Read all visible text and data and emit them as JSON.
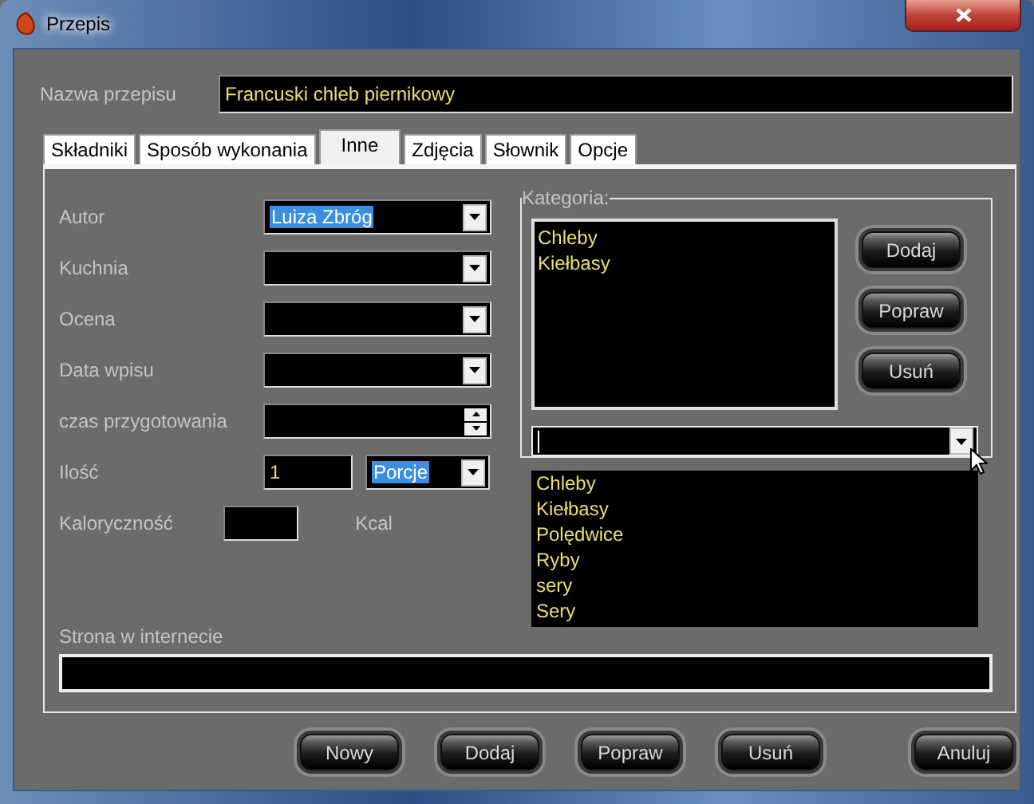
{
  "window": {
    "title": "Przepis"
  },
  "recipe_name": {
    "label": "Nazwa przepisu",
    "value": "Francuski chleb piernikowy"
  },
  "tabs": [
    {
      "label": "Składniki",
      "selected": false
    },
    {
      "label": "Sposób wykonania",
      "selected": false
    },
    {
      "label": "Inne",
      "selected": true
    },
    {
      "label": "Zdjęcia",
      "selected": false
    },
    {
      "label": "Słownik",
      "selected": false
    },
    {
      "label": "Opcje",
      "selected": false
    }
  ],
  "fields": [
    {
      "label": "Autor",
      "kind": "combo",
      "value": "Luiza Zbróg",
      "highlighted": true
    },
    {
      "label": "Kuchnia",
      "kind": "combo"
    },
    {
      "label": "Ocena",
      "kind": "combo"
    },
    {
      "label": "Data wpisu",
      "kind": "combo"
    },
    {
      "label": "czas przygotowania",
      "kind": "spin"
    },
    {
      "label": "Ilość",
      "kind": "amount",
      "value": "1",
      "unit": {
        "value": "Porcje",
        "highlighted": true
      }
    },
    {
      "label": "Kaloryczność",
      "kind": "number",
      "suffix": "Kcal"
    }
  ],
  "category": {
    "label": "Kategoria:",
    "items": [
      "Chleby",
      "Kiełbasy"
    ],
    "buttons": [
      "Dodaj",
      "Popraw",
      "Usuń"
    ],
    "combo": {
      "expanded": true,
      "options": [
        "Chleby",
        "Kiełbasy",
        "Polędwice",
        "Ryby",
        "sery",
        "Sery"
      ]
    }
  },
  "website": {
    "label": "Strona w internecie"
  },
  "buttons": [
    "Nowy",
    "Dodaj",
    "Popraw",
    "Usuń",
    "Anuluj"
  ]
}
